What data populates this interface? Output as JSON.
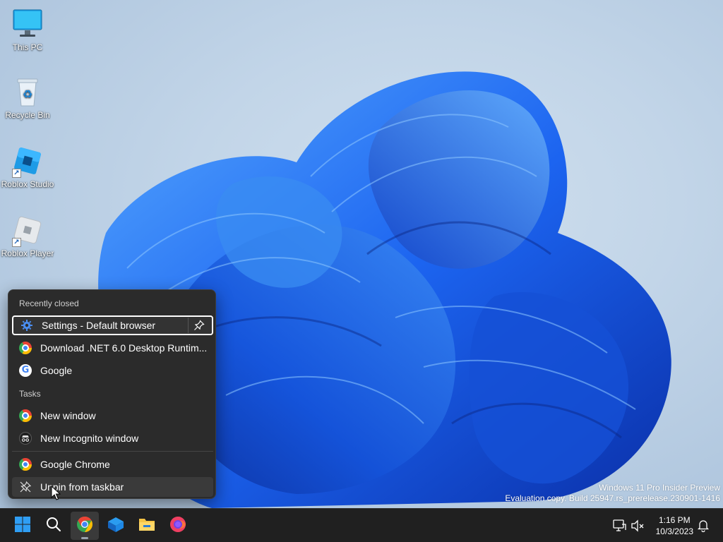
{
  "desktop": {
    "icons": [
      {
        "label": "This PC",
        "icon": "monitor-icon"
      },
      {
        "label": "Recycle Bin",
        "icon": "recycle-bin-icon"
      },
      {
        "label": "Roblox Studio",
        "icon": "roblox-studio-icon"
      },
      {
        "label": "Roblox Player",
        "icon": "roblox-player-icon"
      }
    ],
    "watermark": {
      "line1": "Windows 11 Pro Insider Preview",
      "line2": "Evaluation copy. Build 25947.rs_prerelease.230901-1416"
    }
  },
  "jumplist": {
    "recently_closed_header": "Recently closed",
    "recent_items": [
      {
        "label": "Settings - Default browser",
        "icon": "gear-icon"
      },
      {
        "label": "Download .NET 6.0 Desktop Runtim...",
        "icon": "chrome-icon"
      },
      {
        "label": "Google",
        "icon": "google-icon"
      }
    ],
    "tasks_header": "Tasks",
    "tasks": [
      {
        "label": "New window",
        "icon": "chrome-icon"
      },
      {
        "label": "New Incognito window",
        "icon": "incognito-icon"
      }
    ],
    "app_item": {
      "label": "Google Chrome",
      "icon": "chrome-icon"
    },
    "unpin_item": {
      "label": "Unpin from taskbar",
      "icon": "unpin-icon"
    }
  },
  "taskbar": {
    "apps": [
      "start-icon",
      "search-icon",
      "chrome-icon",
      "store-box-icon",
      "file-explorer-icon",
      "firefox-icon"
    ],
    "active_app": "chrome-icon",
    "tray": {
      "network": "network-icon",
      "volume": "volume-muted-icon",
      "notifications": "bell-icon"
    },
    "clock": {
      "time": "1:16 PM",
      "date": "10/3/2023"
    }
  },
  "colors": {
    "bloom_dark": "#0a2fa8",
    "bloom_light": "#3d8df5",
    "jumplist_bg": "#2b2b2b",
    "taskbar_bg": "#202020"
  }
}
